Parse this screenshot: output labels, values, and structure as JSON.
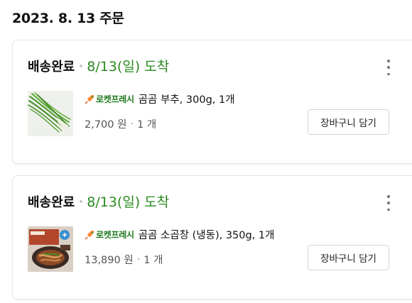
{
  "order": {
    "date_heading": "2023. 8. 13 주문"
  },
  "cards": [
    {
      "status": "배송완료",
      "arrival": "8/13(일) 도착",
      "badge": "로켓프레시",
      "product": "곰곰 부추, 300g, 1개",
      "price": "2,700 원",
      "qty": "1 개",
      "cart_label": "장바구니 담기",
      "thumb_icon": "chives-image"
    },
    {
      "status": "배송완료",
      "arrival": "8/13(일) 도착",
      "badge": "로켓프레시",
      "product": "곰곰 소곱창 (냉동), 350g, 1개",
      "price": "13,890 원",
      "qty": "1 개",
      "cart_label": "장바구니 담기",
      "thumb_icon": "beef-intestine-package-image"
    }
  ],
  "colors": {
    "arrival_green": "#2a8a1f",
    "badge_green": "#1f7a1f"
  }
}
